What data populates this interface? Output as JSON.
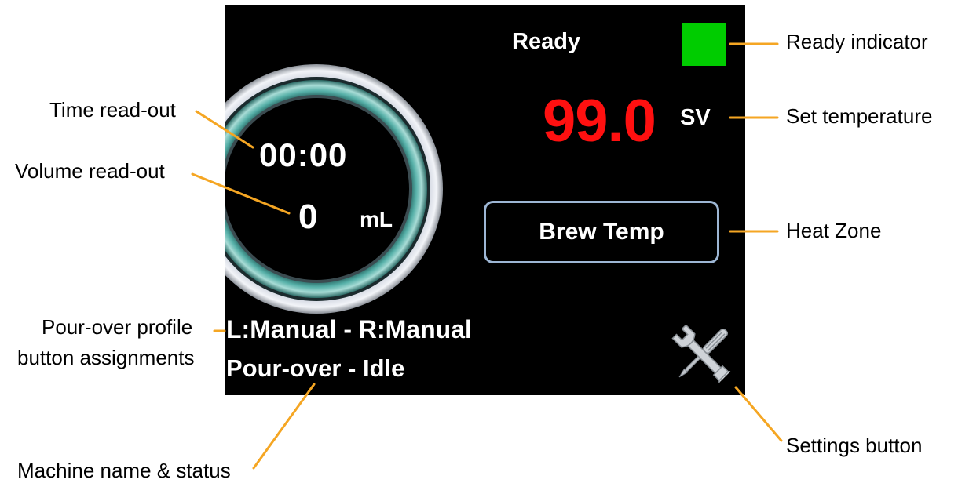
{
  "screen": {
    "time_readout": "00:00",
    "volume_value": "0",
    "volume_unit": "mL",
    "ready_text": "Ready",
    "set_temperature": "99.0",
    "set_temperature_suffix": "SV",
    "heat_zone_button": "Brew Temp",
    "profile_assignments": "L:Manual - R:Manual",
    "machine_status": "Pour-over - Idle"
  },
  "callouts": {
    "ready_indicator": "Ready indicator",
    "set_temperature": "Set temperature",
    "heat_zone": "Heat Zone",
    "settings_button": "Settings button",
    "time_readout": "Time read-out",
    "volume_readout": "Volume read-out",
    "profile_line1": "Pour-over profile",
    "profile_line2": "button assignments",
    "machine_name_status": "Machine name & status"
  },
  "colors": {
    "screen_bg": "#000000",
    "ready_indicator": "#00cc00",
    "set_temperature": "#ff1010",
    "leader_lines": "#f5a623",
    "button_border": "#9db6d4"
  },
  "icons": {
    "settings": "wrench-screwdriver-icon"
  }
}
